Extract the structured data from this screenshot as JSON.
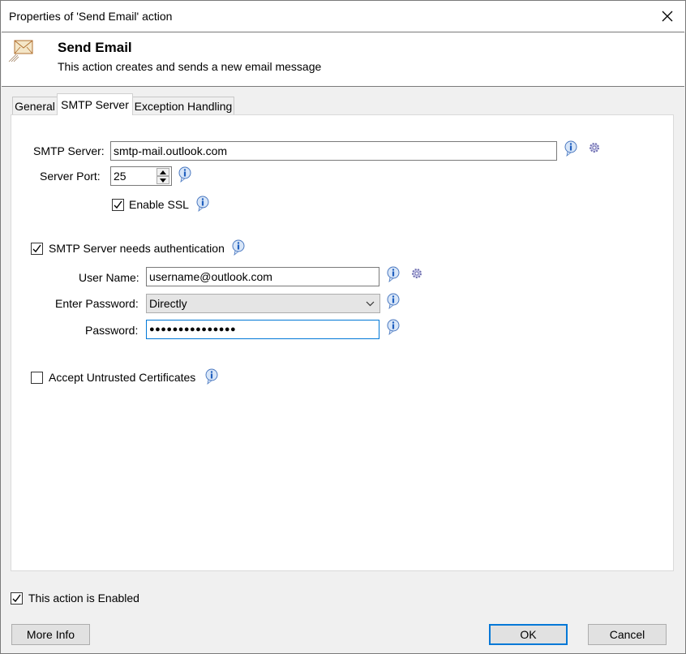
{
  "window": {
    "title": "Properties of 'Send Email' action"
  },
  "header": {
    "title": "Send Email",
    "description": "This action creates and sends a new email message"
  },
  "tabs": [
    {
      "label": "General",
      "active": false
    },
    {
      "label": "SMTP Server",
      "active": true
    },
    {
      "label": "Exception Handling",
      "active": false
    }
  ],
  "smtp": {
    "server_label": "SMTP Server:",
    "server_value": "smtp-mail.outlook.com",
    "port_label": "Server Port:",
    "port_value": "25",
    "ssl_label": "Enable SSL",
    "ssl_checked": true,
    "auth_label": "SMTP Server needs authentication",
    "auth_checked": true,
    "username_label": "User Name:",
    "username_value": "username@outlook.com",
    "password_mode_label": "Enter Password:",
    "password_mode_value": "Directly",
    "password_label": "Password:",
    "password_value": "●●●●●●●●●●●●●●●",
    "untrusted_label": "Accept Untrusted Certificates",
    "untrusted_checked": false
  },
  "footer": {
    "enabled_label": "This action is Enabled",
    "enabled_checked": true,
    "more_info": "More Info",
    "ok": "OK",
    "cancel": "Cancel"
  },
  "colors": {
    "accent": "#0078d7",
    "info_blue": "#1f5fbf",
    "gear_gray": "#8c8cc8"
  }
}
